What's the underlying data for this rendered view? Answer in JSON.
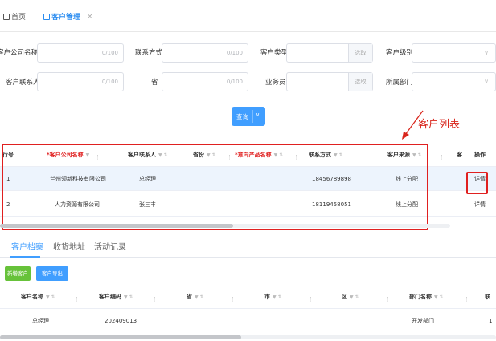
{
  "tabs": {
    "home": "首页",
    "active": "客户管理",
    "close": "×"
  },
  "filters": {
    "company_name": {
      "label": "客户公司名称",
      "counter": "0/100"
    },
    "contact_method": {
      "label": "联系方式",
      "counter": "0/100"
    },
    "customer_type": {
      "label": "客户类型",
      "pick": "选取"
    },
    "customer_level": {
      "label": "客户级别",
      "arrow": "∨"
    },
    "contact_person": {
      "label": "客户联系人",
      "counter": "0/100"
    },
    "province": {
      "label": "省",
      "counter": "0/100"
    },
    "salesman": {
      "label": "业务员",
      "pick": "选取"
    },
    "department": {
      "label": "所属部门",
      "arrow": "∨"
    }
  },
  "query_button": {
    "label": "查询",
    "dropdown": "∨"
  },
  "annotation": {
    "label": "客户列表",
    "color": "#d9261c"
  },
  "customer_table": {
    "headers": {
      "index": "行号",
      "company": "*客户公司名称",
      "contact": "客户联系人",
      "province": "省份",
      "product": "*意向产品名称",
      "phone": "联系方式",
      "source": "客户来源",
      "truncated": "客",
      "action": "操作"
    },
    "rows": [
      {
        "index": "1",
        "company": "兰州领新科技有限公司",
        "contact": "总经理",
        "province": "",
        "product": "",
        "phone": "18456789898",
        "source": "线上分配",
        "action": "详情"
      },
      {
        "index": "2",
        "company": "人力资源有限公司",
        "contact": "张三丰",
        "province": "",
        "product": "",
        "phone": "18119458051",
        "source": "线上分配",
        "action": "详情"
      }
    ]
  },
  "detail_tabs": {
    "profile": "客户档案",
    "address": "收货地址",
    "activity": "活动记录"
  },
  "profile_buttons": {
    "add": "新增客户",
    "export": "客户导出"
  },
  "profile_table": {
    "headers": {
      "name": "客户名称",
      "code": "客户编码",
      "province": "省",
      "city": "市",
      "district": "区",
      "dept": "部门名称",
      "truncated": "联"
    },
    "rows": [
      {
        "name": "总经理",
        "code": "202409013",
        "province": "",
        "city": "",
        "district": "",
        "dept": "开发部门",
        "truncated": "1"
      }
    ]
  },
  "colors": {
    "accent": "#409eff",
    "highlight_box": "#e02020",
    "add_button": "#67c23a"
  }
}
